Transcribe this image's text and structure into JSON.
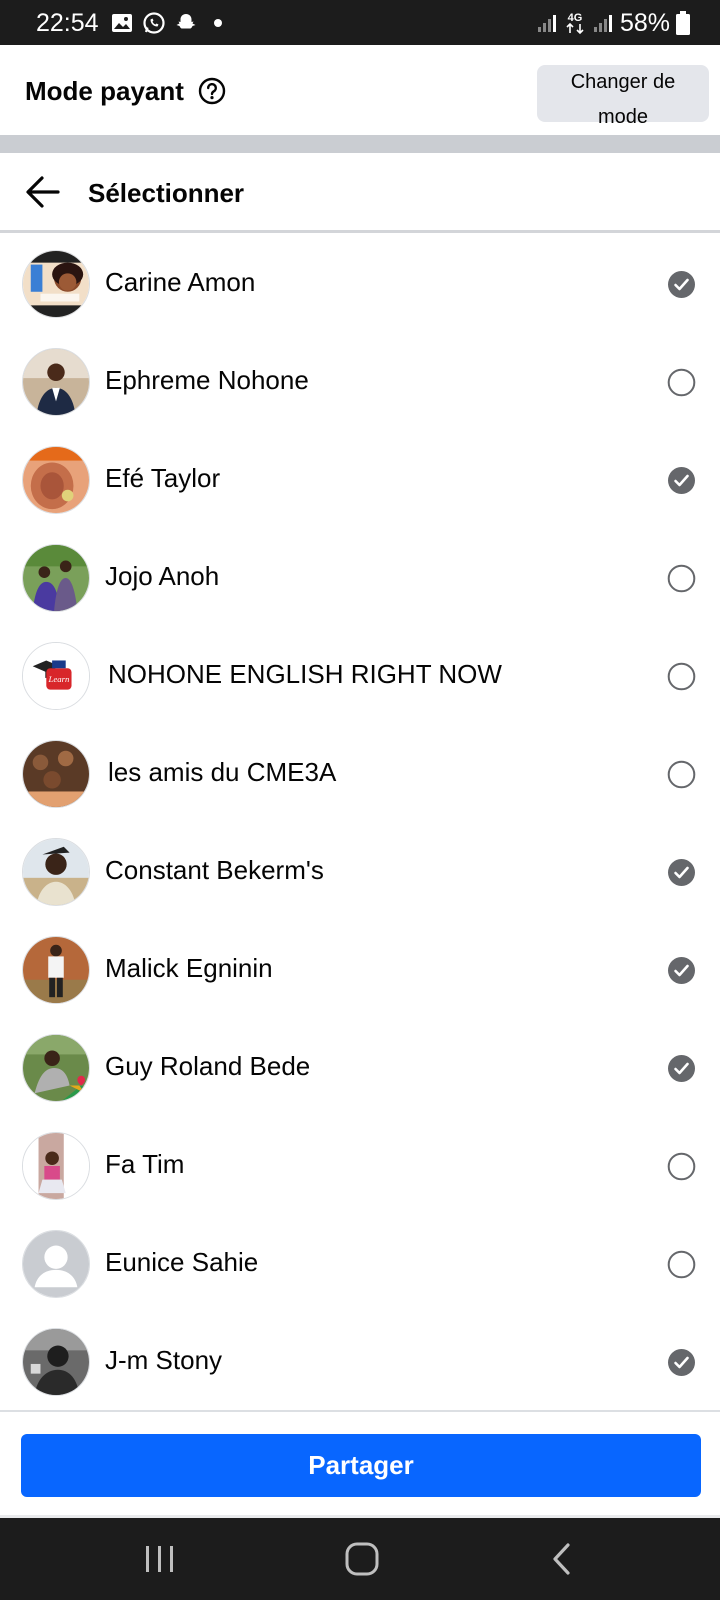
{
  "status_bar": {
    "time": "22:54",
    "left_icons": [
      "gallery-icon",
      "whatsapp-icon",
      "snapchat-icon",
      "dot-icon"
    ],
    "network": "4G",
    "battery": "58%"
  },
  "header": {
    "title": "Mode payant",
    "change_mode_line1": "Changer de",
    "change_mode_line2": "mode"
  },
  "select_header": {
    "title": "Sélectionner"
  },
  "friends": [
    {
      "name": "Carine Amon",
      "selected": true
    },
    {
      "name": "Ephreme Nohone",
      "selected": false
    },
    {
      "name": "Efé Taylor",
      "selected": true
    },
    {
      "name": "Jojo Anoh",
      "selected": false
    },
    {
      "name": "NOHONE ENGLISH RIGHT NOW",
      "selected": false
    },
    {
      "name": "les amis du CME3A",
      "selected": false
    },
    {
      "name": "Constant Bekerm's",
      "selected": true
    },
    {
      "name": "Malick Egninin",
      "selected": true
    },
    {
      "name": "Guy Roland Bede",
      "selected": true
    },
    {
      "name": "Fa Tim",
      "selected": false
    },
    {
      "name": "Eunice Sahie",
      "selected": false
    },
    {
      "name": "J-m Stony",
      "selected": true
    }
  ],
  "footer": {
    "share_label": "Partager"
  },
  "colors": {
    "primary": "#0866ff",
    "checked": "#65676b",
    "status_bar": "#1c1c1c"
  }
}
